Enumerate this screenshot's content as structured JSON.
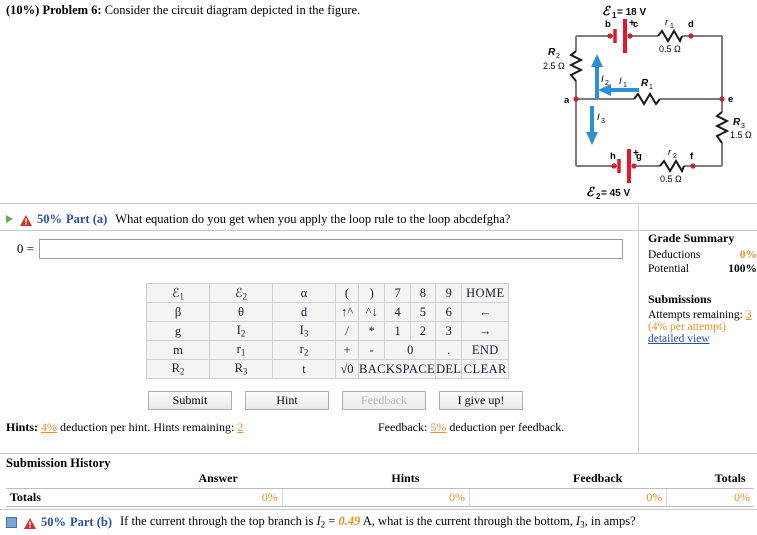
{
  "problem": {
    "weight": "(10%)",
    "number": "Problem 6:",
    "statement": "Consider the circuit diagram depicted in the figure."
  },
  "figure": {
    "emf1_label": "ℰ",
    "emf1_sub": "1",
    "emf1_value": "= 18 V",
    "emf2_label": "ℰ",
    "emf2_sub": "2",
    "emf2_value": "= 45 V",
    "r1_label": "r",
    "r1_sub": "1",
    "r1_value": "0.5 Ω",
    "r2_label": "r",
    "r2_sub": "2",
    "r2_value": "0.5 Ω",
    "R1_label": "R",
    "R1_sub": "1",
    "R2_label": "R",
    "R2_sub": "2",
    "R2_value": "2.5 Ω",
    "R3_label": "R",
    "R3_sub": "3",
    "R3_value": "1.5 Ω",
    "I1_label": "I",
    "I1_sub": "1",
    "I2_label": "I",
    "I2_sub": "2",
    "I3_label": "I",
    "I3_sub": "3",
    "node_a": "a",
    "node_b": "b",
    "node_c": "c",
    "node_d": "d",
    "node_e": "e",
    "node_f": "f",
    "node_g": "g",
    "node_h": "h",
    "plus1": "+",
    "plus2": "+",
    "wire_color": "#808080",
    "node_color": "#cc2233",
    "battery_color": "#e8152a",
    "current_color": "#2f8fd6"
  },
  "part_a": {
    "percent": "50%",
    "label": "Part (a)",
    "question": "What equation do you get when you apply the loop rule to the loop abcdefgha?",
    "eq_prefix": "0 =",
    "input_value": "",
    "input_placeholder": ""
  },
  "keypad": {
    "rows": [
      [
        {
          "t": "ℰ",
          "s": "1",
          "c": "k-sym"
        },
        {
          "t": "ℰ",
          "s": "2",
          "c": "k-sym"
        },
        {
          "t": "α",
          "s": "",
          "c": "k-sym"
        },
        {
          "t": "(",
          "s": "",
          "c": "k-op"
        },
        {
          "t": ")",
          "s": "",
          "c": "k-op k-dis"
        },
        {
          "t": "7",
          "s": "",
          "c": "k-num"
        },
        {
          "t": "8",
          "s": "",
          "c": "k-num"
        },
        {
          "t": "9",
          "s": "",
          "c": "k-num"
        },
        {
          "t": "HOME",
          "s": "",
          "c": "k-fn"
        }
      ],
      [
        {
          "t": "β",
          "s": "",
          "c": "k-sym"
        },
        {
          "t": "θ",
          "s": "",
          "c": "k-sym"
        },
        {
          "t": "d",
          "s": "",
          "c": "k-sym"
        },
        {
          "t": "↑^",
          "s": "",
          "c": "k-op k-dis"
        },
        {
          "t": "^↓",
          "s": "",
          "c": "k-op k-dis"
        },
        {
          "t": "4",
          "s": "",
          "c": "k-num"
        },
        {
          "t": "5",
          "s": "",
          "c": "k-num"
        },
        {
          "t": "6",
          "s": "",
          "c": "k-num"
        },
        {
          "t": "←",
          "s": "",
          "c": "k-fn"
        }
      ],
      [
        {
          "t": "g",
          "s": "",
          "c": "k-sym"
        },
        {
          "t": "I",
          "s": "2",
          "c": "k-sym"
        },
        {
          "t": "I",
          "s": "3",
          "c": "k-sym"
        },
        {
          "t": "/",
          "s": "",
          "c": "k-op k-dis"
        },
        {
          "t": "*",
          "s": "",
          "c": "k-op k-dis"
        },
        {
          "t": "1",
          "s": "",
          "c": "k-num"
        },
        {
          "t": "2",
          "s": "",
          "c": "k-num"
        },
        {
          "t": "3",
          "s": "",
          "c": "k-num"
        },
        {
          "t": "→",
          "s": "",
          "c": "k-fn"
        }
      ],
      [
        {
          "t": "m",
          "s": "",
          "c": "k-sym"
        },
        {
          "t": "r",
          "s": "1",
          "c": "k-sym"
        },
        {
          "t": "r",
          "s": "2",
          "c": "k-sym"
        },
        {
          "t": "+",
          "s": "",
          "c": "k-op"
        },
        {
          "t": "-",
          "s": "",
          "c": "k-op"
        },
        {
          "t": "0",
          "s": "",
          "c": "k-num k-wide",
          "span": 2
        },
        {
          "t": ".",
          "s": "",
          "c": "k-num"
        },
        {
          "t": "END",
          "s": "",
          "c": "k-fn"
        }
      ],
      [
        {
          "t": "R",
          "s": "2",
          "c": "k-sym"
        },
        {
          "t": "R",
          "s": "3",
          "c": "k-sym"
        },
        {
          "t": "t",
          "s": "",
          "c": "k-sym"
        },
        {
          "t": "√0",
          "s": "",
          "c": "k-op"
        },
        {
          "t": "BACKSPACE",
          "s": "",
          "c": "k-bksp",
          "span": 3
        },
        {
          "t": "DEL",
          "s": "",
          "c": "k-del"
        },
        {
          "t": "CLEAR",
          "s": "",
          "c": "k-fn"
        }
      ]
    ]
  },
  "buttons": {
    "submit": "Submit",
    "hint": "Hint",
    "feedback": "Feedback",
    "giveup": "I give up!"
  },
  "hints": {
    "label": "Hints:",
    "deduction": "4%",
    "text1": "deduction per hint. Hints remaining:",
    "remaining": "2",
    "feedback_label": "Feedback:",
    "feedback_deduction": "5%",
    "feedback_text": "deduction per feedback."
  },
  "grade_summary": {
    "title": "Grade Summary",
    "deductions_label": "Deductions",
    "deductions_value": "0%",
    "potential_label": "Potential",
    "potential_value": "100%",
    "submissions_title": "Submissions",
    "attempts_label": "Attempts remaining:",
    "attempts_value": "3",
    "per_attempt": "(4% per attempt)",
    "detailed_view": "detailed view"
  },
  "submission_history": {
    "title": "Submission History",
    "columns": [
      "Answer",
      "Hints",
      "Feedback",
      "Totals"
    ],
    "row_label": "Totals",
    "values": [
      "0%",
      "0%",
      "0%",
      "0%"
    ]
  },
  "part_b": {
    "percent": "50%",
    "label": "Part (b)",
    "text_before": "If the current through the top branch is",
    "var1": "I",
    "var1_sub": "2",
    "equals": "=",
    "value": "0.49",
    "unit": "A, what is the current through the bottom,",
    "var2": "I",
    "var2_sub": "3",
    "text_after": ", in amps?"
  }
}
